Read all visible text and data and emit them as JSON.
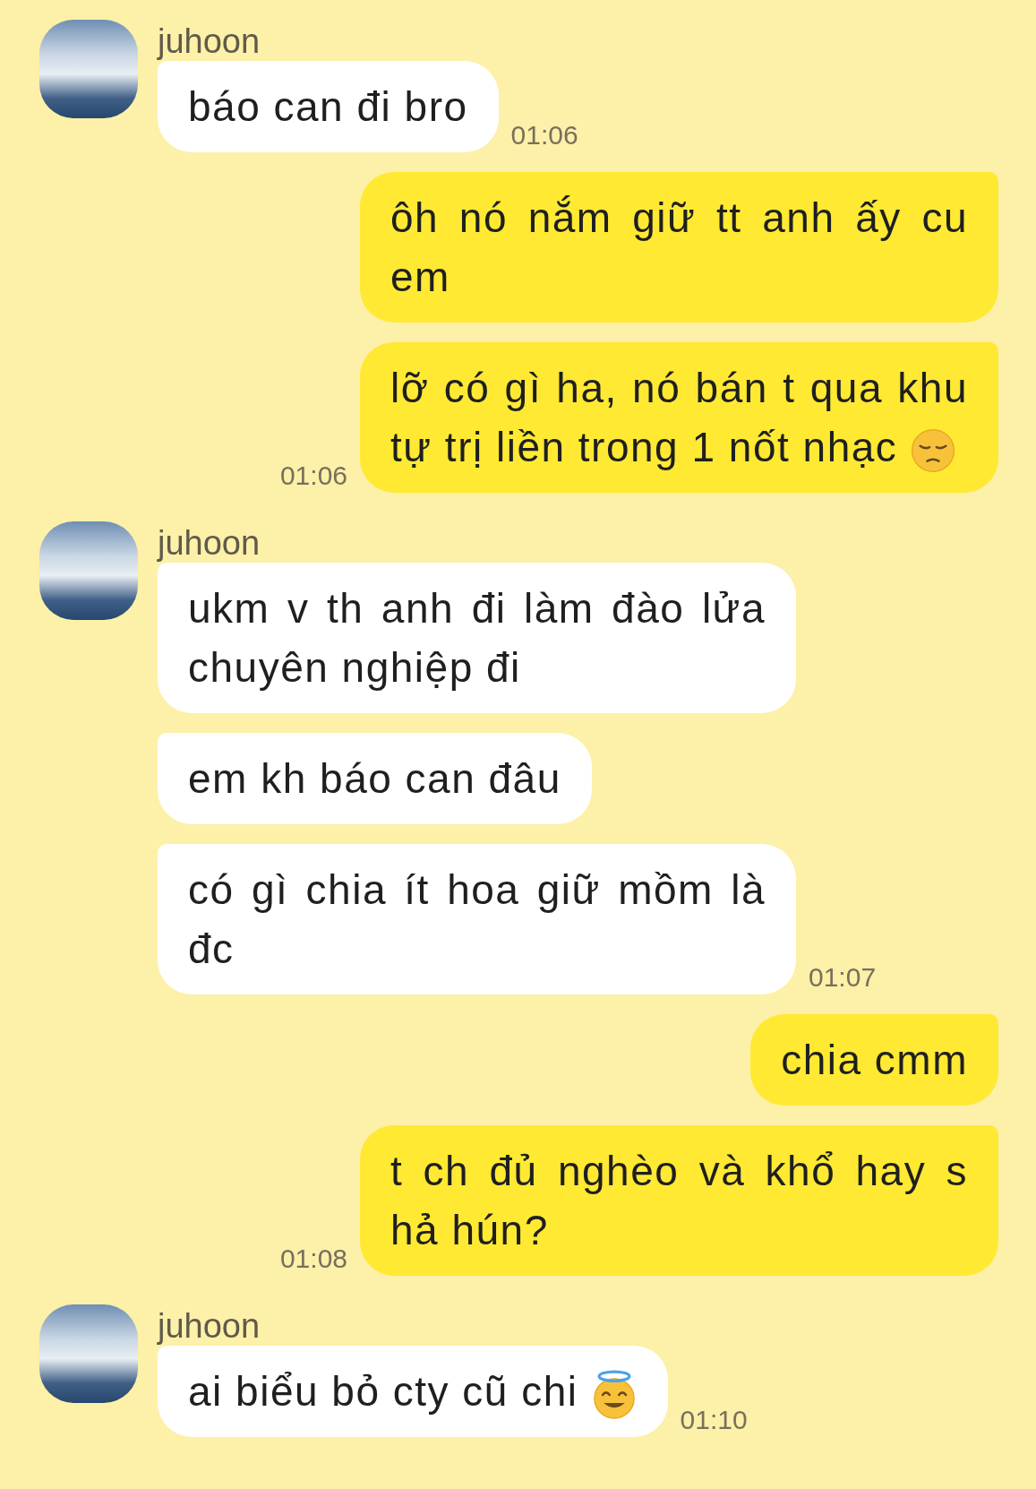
{
  "groups": [
    {
      "kind": "incoming",
      "sender": "juhoon",
      "messages": [
        {
          "kind": "plain",
          "text": "báo can đi bro",
          "time": "01:06"
        }
      ]
    },
    {
      "kind": "outgoing",
      "messages": [
        {
          "kind": "plain",
          "text": "ôh nó nắm giữ tt anh ấy cu em"
        },
        {
          "kind": "pensive",
          "text": "lỡ có gì ha, nó bán t qua khu tự trị liền trong 1 nốt nhạc",
          "time": "01:06"
        }
      ]
    },
    {
      "kind": "incoming",
      "sender": "juhoon",
      "messages": [
        {
          "kind": "plain",
          "text": "ukm v th anh đi làm đào lửa chuyên nghiệp đi"
        },
        {
          "kind": "plain",
          "text": "em kh báo can đâu"
        },
        {
          "kind": "plain",
          "text": "có gì chia ít hoa giữ mồm là đc",
          "time": "01:07"
        }
      ]
    },
    {
      "kind": "outgoing",
      "messages": [
        {
          "kind": "plain",
          "text": "chia cmm"
        },
        {
          "kind": "plain",
          "text": "t ch đủ nghèo và khổ hay s hả hún?",
          "time": "01:08"
        }
      ]
    },
    {
      "kind": "incoming",
      "sender": "juhoon",
      "messages": [
        {
          "kind": "halo",
          "text": "ai biểu bỏ cty cũ chi",
          "time": "01:10"
        }
      ]
    }
  ]
}
